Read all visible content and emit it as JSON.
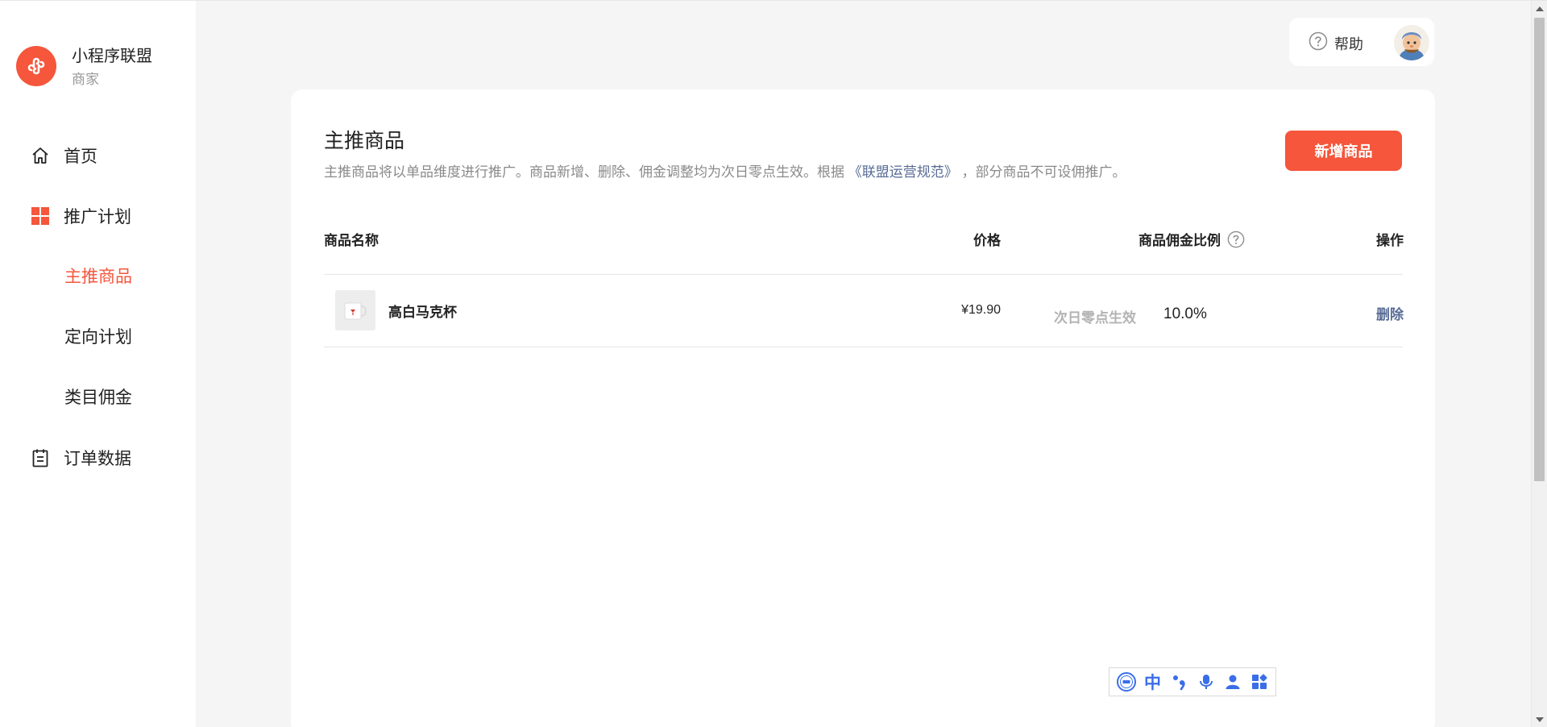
{
  "brand": {
    "title": "小程序联盟",
    "subtitle": "商家"
  },
  "sidebar": {
    "items": [
      {
        "label": "首页",
        "icon": "home-icon"
      },
      {
        "label": "推广计划",
        "icon": "grid-icon"
      },
      {
        "label": "主推商品",
        "active": true
      },
      {
        "label": "定向计划"
      },
      {
        "label": "类目佣金"
      },
      {
        "label": "订单数据",
        "icon": "clipboard-icon"
      }
    ]
  },
  "topbar": {
    "help_label": "帮助",
    "help_icon": "question-circle-icon",
    "avatar_icon": "avatar-icon"
  },
  "main": {
    "title": "主推商品",
    "desc_prefix": "主推商品将以单品维度进行推广。商品新增、删除、佣金调整均为次日零点生效。根据",
    "desc_link": "《联盟运营规范》",
    "desc_suffix": "，部分商品不可设佣推广。",
    "add_button": "新增商品",
    "columns": {
      "name": "商品名称",
      "price": "价格",
      "commission": "商品佣金比例",
      "operation": "操作"
    },
    "rows": [
      {
        "name": "高白马克杯",
        "price": "¥19.90",
        "status": "次日零点生效",
        "commission": "10.0%",
        "action": "删除"
      }
    ]
  },
  "ime": {
    "zh_label": "中",
    "icons": [
      "ifly-logo-icon",
      "punctuation-icon",
      "microphone-icon",
      "user-icon",
      "apps-icon"
    ]
  },
  "colors": {
    "accent": "#f5563c",
    "link": "#576b95",
    "ime": "#3a6ee8"
  }
}
